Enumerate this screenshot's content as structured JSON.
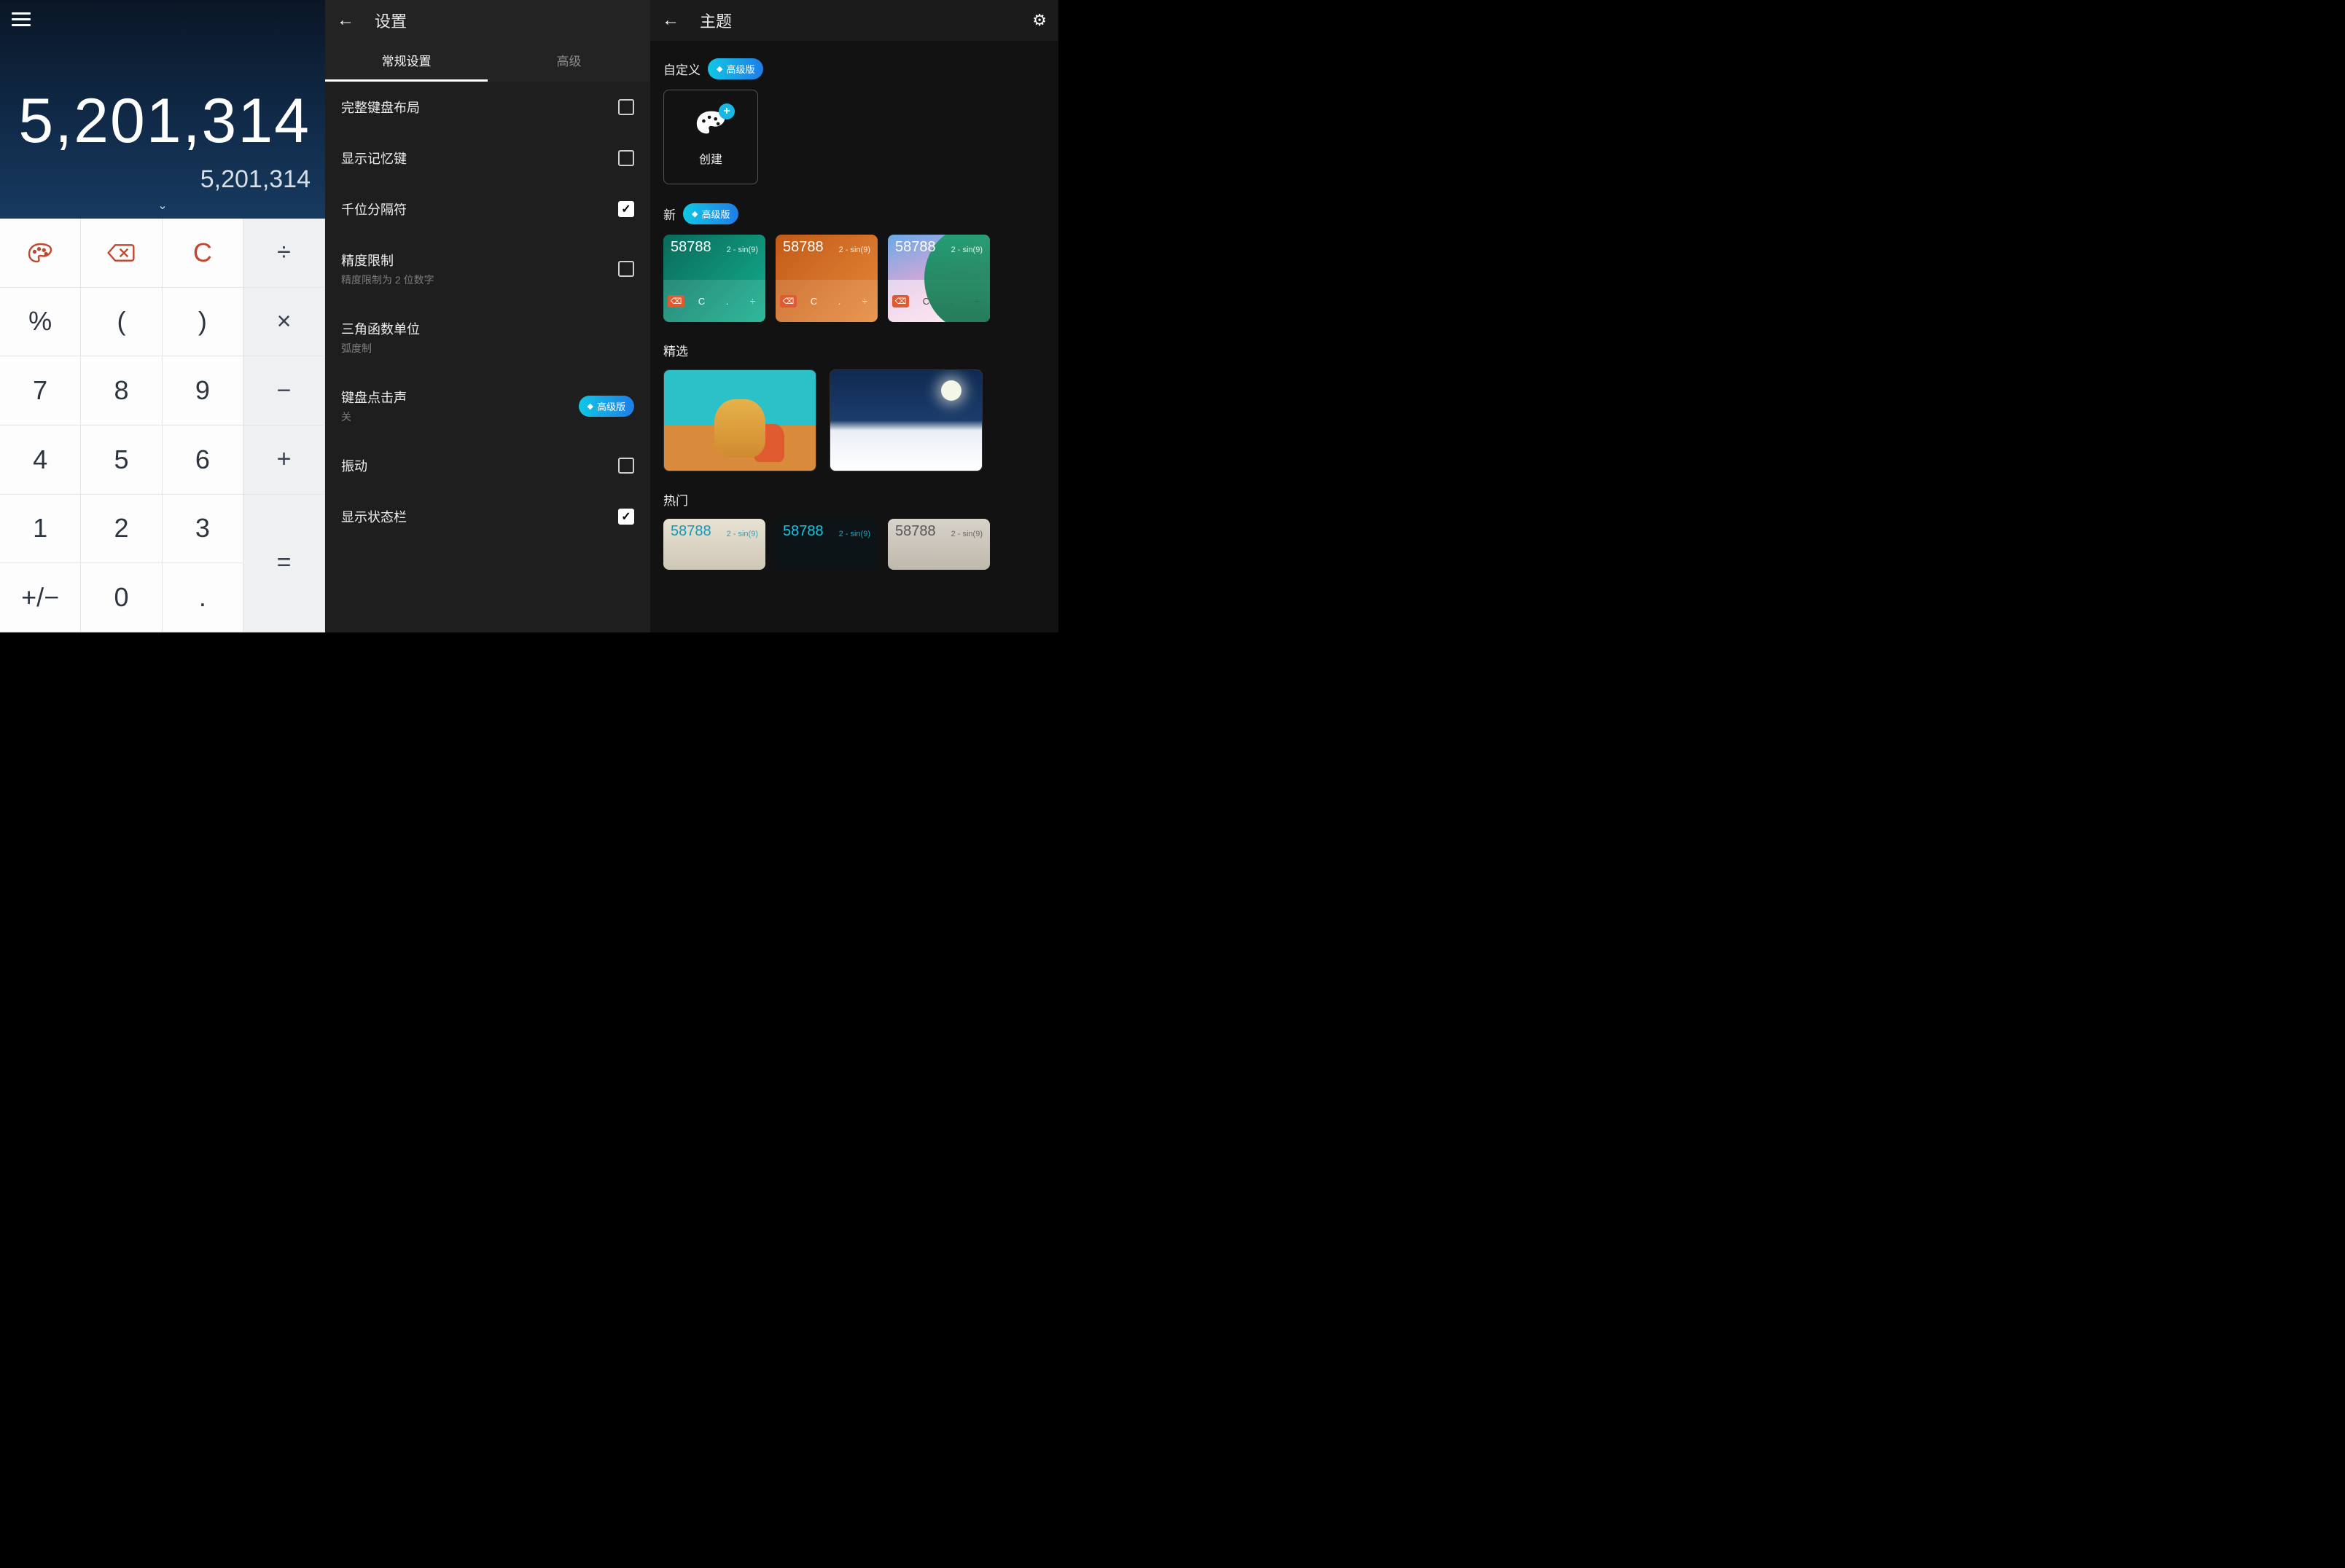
{
  "calc": {
    "main": "5,201,314",
    "sub": "5,201,314",
    "keys": {
      "theme": "",
      "backspace": "",
      "clear": "C",
      "divide": "÷",
      "percent": "%",
      "lparen": "(",
      "rparen": ")",
      "multiply": "×",
      "k7": "7",
      "k8": "8",
      "k9": "9",
      "minus": "−",
      "k4": "4",
      "k5": "5",
      "k6": "6",
      "plus": "+",
      "k1": "1",
      "k2": "2",
      "k3": "3",
      "equals": "=",
      "sign": "+/−",
      "k0": "0",
      "dot": "."
    }
  },
  "settings": {
    "title": "设置",
    "tabs": {
      "general": "常规设置",
      "advanced": "高级"
    },
    "items": [
      {
        "title": "完整键盘布局",
        "sub": "",
        "ctrl": "check",
        "on": false
      },
      {
        "title": "显示记忆键",
        "sub": "",
        "ctrl": "check",
        "on": false
      },
      {
        "title": "千位分隔符",
        "sub": "",
        "ctrl": "check",
        "on": true
      },
      {
        "title": "精度限制",
        "sub": "精度限制为 2 位数字",
        "ctrl": "check",
        "on": false
      },
      {
        "title": "三角函数单位",
        "sub": "弧度制",
        "ctrl": "none"
      },
      {
        "title": "键盘点击声",
        "sub": "关",
        "ctrl": "pro"
      },
      {
        "title": "振动",
        "sub": "",
        "ctrl": "check",
        "on": false
      },
      {
        "title": "显示状态栏",
        "sub": "",
        "ctrl": "check",
        "on": true
      }
    ],
    "pro_label": "高级版"
  },
  "themes": {
    "title": "主题",
    "sections": {
      "custom": "自定义",
      "new": "新",
      "featured": "精选",
      "hot": "热门"
    },
    "pro_label": "高级版",
    "create_label": "创建",
    "thumb_num": "58788",
    "thumb_expr": "2 - sin(9)",
    "thumb_keys": {
      "bx": "⌫",
      "c": "C",
      "dot": ".",
      "div": "÷"
    }
  }
}
